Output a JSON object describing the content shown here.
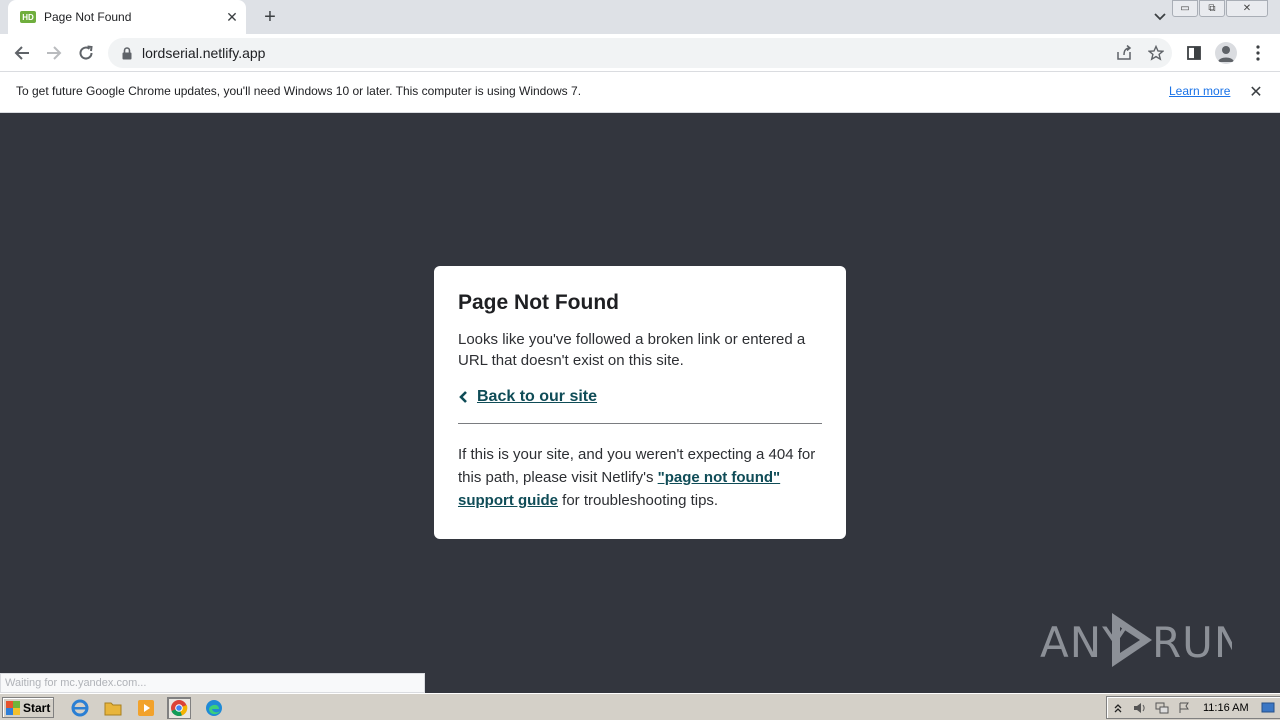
{
  "browser": {
    "tab": {
      "title": "Page Not Found",
      "favicon_text": "HD",
      "close": "✕"
    },
    "new_tab": "+",
    "url": "lordserial.netlify.app",
    "window_controls": {
      "minimize": "▭",
      "restore": "⧉",
      "close": "✕"
    }
  },
  "infobar": {
    "message": "To get future Google Chrome updates, you'll need Windows 10 or later. This computer is using Windows 7.",
    "link": "Learn more",
    "close": "✕"
  },
  "page": {
    "title": "Page Not Found",
    "lead": "Looks like you've followed a broken link or entered a URL that doesn't exist on this site.",
    "back_link": "Back to our site",
    "foot_prefix": "If this is your site, and you weren't expecting a 404 for this path, please visit Netlify's ",
    "foot_link": "\"page not found\" support guide",
    "foot_suffix": " for troubleshooting tips."
  },
  "status_bubble": "Waiting for mc.yandex.com...",
  "watermark": "ANY RUN",
  "taskbar": {
    "start": "Start",
    "clock": "11:16 AM"
  },
  "colors": {
    "page_bg": "#33363e",
    "link": "#0f4c57",
    "chrome_link": "#1a73e8"
  }
}
